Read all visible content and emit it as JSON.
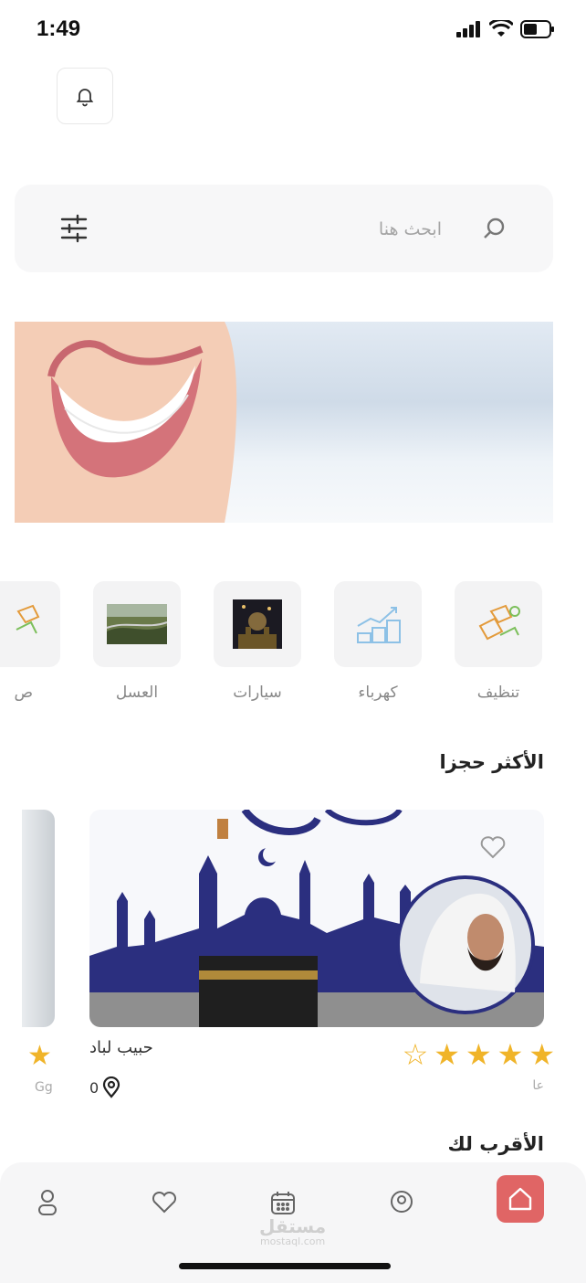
{
  "status_bar": {
    "time": "1:49"
  },
  "search": {
    "placeholder": "ابحث هنا"
  },
  "categories": [
    {
      "label": "تنظيف",
      "icon": "cleaning-icon"
    },
    {
      "label": "كهرباء",
      "icon": "electricity-icon"
    },
    {
      "label": "سيارات",
      "icon": "cars-image"
    },
    {
      "label": "العسل",
      "icon": "honey-image"
    },
    {
      "label": "ص",
      "icon": "partial-category-icon"
    }
  ],
  "sections": {
    "most_booked": "الأكثر حجزا",
    "nearest": "الأقرب لك"
  },
  "featured_card": {
    "provider": "حبيب لباد",
    "rating": 4,
    "max_rating": 5,
    "distance": "0",
    "category_short": "عا"
  },
  "peek_card": {
    "category_short": "Gg"
  },
  "watermark": {
    "ar": "مستقل",
    "en": "mostaql.com"
  },
  "colors": {
    "accent": "#e06565",
    "star": "#f0b429",
    "kaaba_blue": "#2b2f7f"
  }
}
